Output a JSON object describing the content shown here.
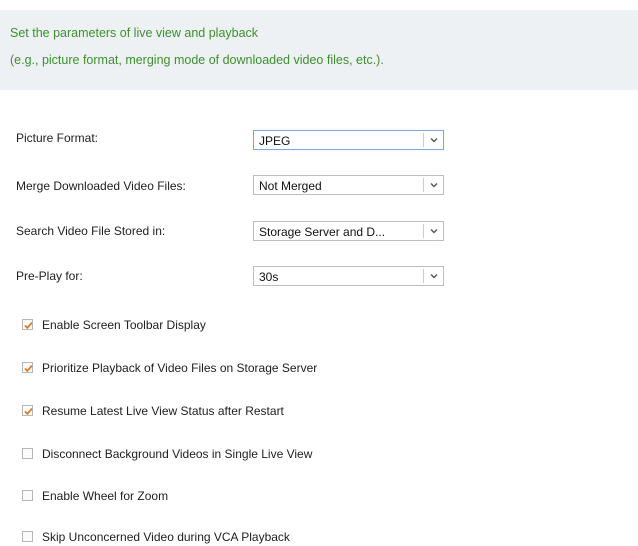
{
  "header": {
    "line1": "Set the parameters of live view and playback",
    "line2": "(e.g., picture format, merging mode of downloaded video files, etc.)."
  },
  "settings": [
    {
      "label": "Picture Format:",
      "value": "JPEG"
    },
    {
      "label": "Merge Downloaded Video Files:",
      "value": "Not Merged"
    },
    {
      "label": "Search Video File Stored in:",
      "value": "Storage Server and D..."
    },
    {
      "label": "Pre-Play for:",
      "value": "30s"
    }
  ],
  "options": [
    {
      "label": "Enable Screen Toolbar Display",
      "checked": true
    },
    {
      "label": "Prioritize Playback of Video Files on Storage Server",
      "checked": true
    },
    {
      "label": "Resume Latest Live View Status after Restart",
      "checked": true
    },
    {
      "label": "Disconnect Background Videos in Single Live View",
      "checked": false
    },
    {
      "label": "Enable Wheel for Zoom",
      "checked": false
    },
    {
      "label": "Skip Unconcerned Video during VCA Playback",
      "checked": false
    }
  ],
  "icons": {
    "dropdown": "chevron-down-icon",
    "check": "checkmark-icon"
  },
  "colors": {
    "header_text": "#3d8f2f",
    "header_bg": "#eef1f4",
    "checkmark": "#e07a1f"
  }
}
